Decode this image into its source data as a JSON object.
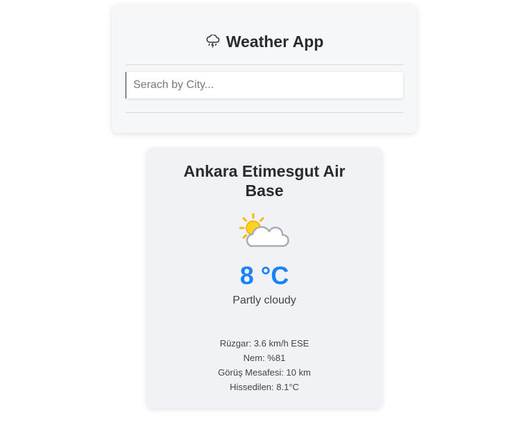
{
  "header": {
    "title": "Weather App",
    "title_icon": "cloud-rain-lightning-icon"
  },
  "search": {
    "placeholder": "Serach by City...",
    "value": ""
  },
  "weather": {
    "city": "Ankara Etimesgut Air Base",
    "icon": "partly-cloudy-icon",
    "temperature": "8 °C",
    "condition": "Partly cloudy",
    "wind": "Rüzgar: 3.6 km/h ESE",
    "humidity": "Nem: %81",
    "visibility": "Görüş Mesafesi: 10 km",
    "feels_like": "Hissedilen: 8.1°C"
  },
  "colors": {
    "temperature": "#1a82ff",
    "card_background": "#f0f2f6",
    "header_background": "#f6f7f9"
  }
}
